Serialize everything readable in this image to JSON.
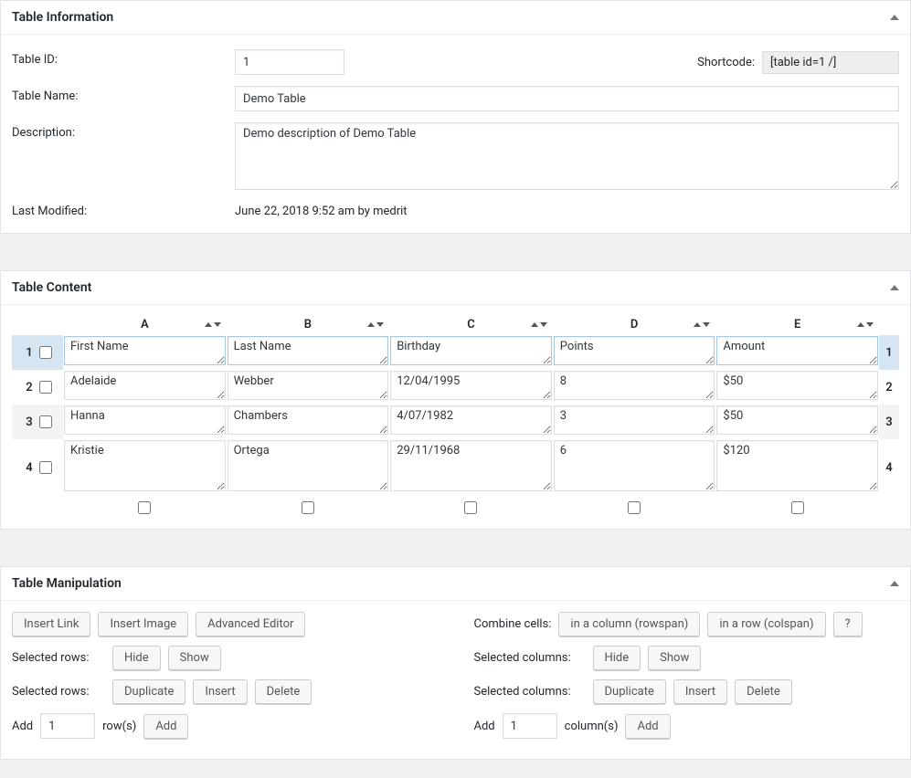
{
  "info": {
    "heading": "Table Information",
    "id_label": "Table ID:",
    "id_value": "1",
    "shortcode_label": "Shortcode:",
    "shortcode_value": "[table id=1 /]",
    "name_label": "Table Name:",
    "name_value": "Demo Table",
    "desc_label": "Description:",
    "desc_value": "Demo description of Demo Table",
    "modified_label": "Last Modified:",
    "modified_value": "June 22, 2018 9:52 am by medrit"
  },
  "content": {
    "heading": "Table Content",
    "columns": [
      "A",
      "B",
      "C",
      "D",
      "E"
    ],
    "rows": [
      {
        "num": "1",
        "cells": [
          "First Name",
          "Last Name",
          "Birthday",
          "Points",
          "Amount"
        ]
      },
      {
        "num": "2",
        "cells": [
          "Adelaide",
          "Webber",
          "12/04/1995",
          "8",
          "$50"
        ]
      },
      {
        "num": "3",
        "cells": [
          "Hanna",
          "Chambers",
          "4/07/1982",
          "3",
          "$50"
        ]
      },
      {
        "num": "4",
        "cells": [
          "Kristie",
          "Ortega",
          "29/11/1968",
          "6",
          "$120"
        ]
      }
    ]
  },
  "manip": {
    "heading": "Table Manipulation",
    "insert_link": "Insert Link",
    "insert_image": "Insert Image",
    "advanced_editor": "Advanced Editor",
    "combine_label": "Combine cells:",
    "rowspan": "in a column (rowspan)",
    "colspan": "in a row (colspan)",
    "help": "?",
    "sel_rows_label": "Selected rows:",
    "sel_cols_label": "Selected columns:",
    "hide": "Hide",
    "show": "Show",
    "duplicate": "Duplicate",
    "insert": "Insert",
    "delete": "Delete",
    "add_label": "Add",
    "add_rows_val": "1",
    "rows_suffix": "row(s)",
    "add_cols_val": "1",
    "cols_suffix": "column(s)",
    "add_btn": "Add"
  }
}
